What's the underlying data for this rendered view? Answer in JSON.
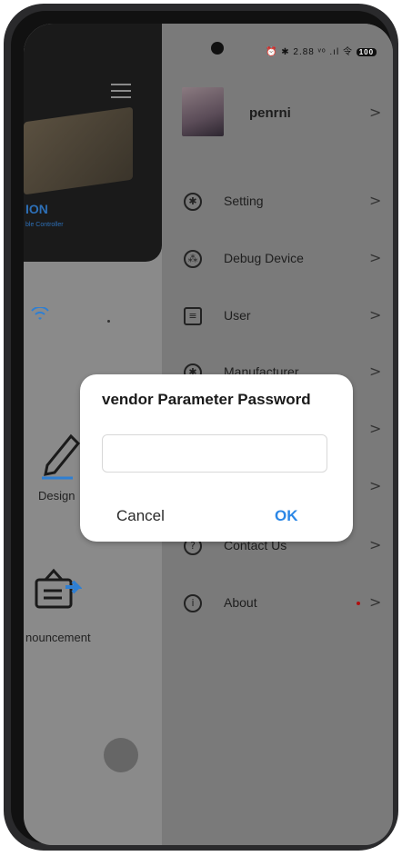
{
  "status_bar": {
    "icons": "⏰ ✱ 2.88 ᵛᵒ .ıl 令",
    "battery": "100"
  },
  "app": {
    "brand_title": "ION",
    "brand_subtitle": "ble Controller",
    "design_label": "Design",
    "announcement_label": "nouncement"
  },
  "drawer": {
    "username": "penrni",
    "items": [
      {
        "label": "Setting",
        "icon": "gear-icon"
      },
      {
        "label": "Debug Device",
        "icon": "debug-icon"
      },
      {
        "label": "User",
        "icon": "user-icon"
      },
      {
        "label": "Manufacturer",
        "icon": "manufacturer-icon"
      },
      {
        "label": "",
        "icon": "hidden-icon"
      },
      {
        "label": "",
        "icon": "hidden-icon"
      },
      {
        "label": "Contact Us",
        "icon": "question-icon"
      },
      {
        "label": "About",
        "icon": "info-icon"
      }
    ]
  },
  "dialog": {
    "title": "vendor Parameter Password",
    "input_value": "",
    "cancel_label": "Cancel",
    "ok_label": "OK"
  },
  "colors": {
    "accent": "#2b87e6",
    "brand": "#2d6fb6",
    "scrim": "#7b7b7b"
  }
}
